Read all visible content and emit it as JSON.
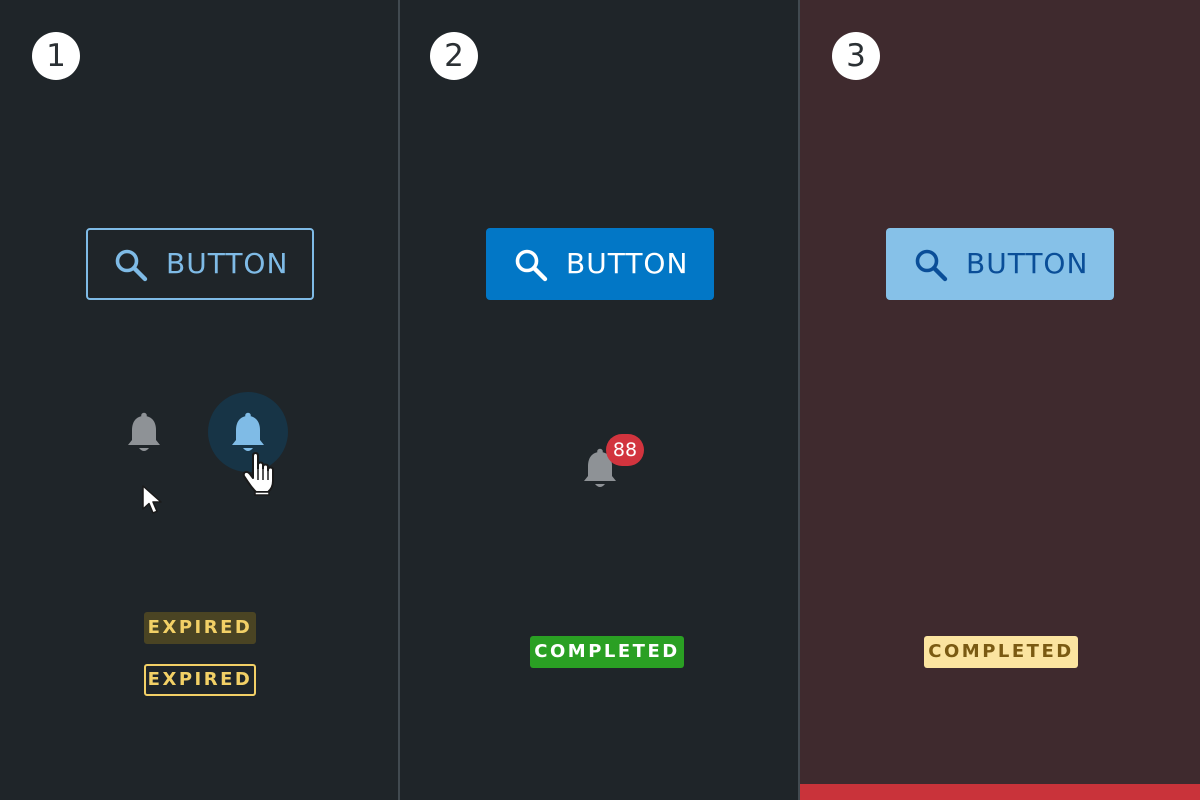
{
  "panels": [
    {
      "number": "1",
      "button": {
        "label": "BUTTON",
        "style": "outline",
        "icon": "search-icon"
      },
      "bells": [
        {
          "icon": "bell-icon",
          "state": "default"
        },
        {
          "icon": "bell-icon",
          "state": "hover"
        }
      ],
      "badges": [
        {
          "text": "EXPIRED",
          "style": "filled"
        },
        {
          "text": "EXPIRED",
          "style": "outline"
        }
      ]
    },
    {
      "number": "2",
      "button": {
        "label": "BUTTON",
        "style": "solid",
        "icon": "search-icon"
      },
      "bell": {
        "icon": "bell-icon",
        "count": "88"
      },
      "badges": [
        {
          "text": "COMPLETED",
          "style": "green"
        }
      ]
    },
    {
      "number": "3",
      "button": {
        "label": "BUTTON",
        "style": "light",
        "icon": "search-icon"
      },
      "badges": [
        {
          "text": "COMPLETED",
          "style": "yellow"
        }
      ]
    }
  ],
  "colors": {
    "panel_bg": "#1f2529",
    "panel3_bg": "#3f2a2e",
    "accent_blue": "#0277c6",
    "light_blue": "#86c1e8",
    "expired_yellow": "#f2d066",
    "completed_green": "#2aa023",
    "notification_red": "#d2343e"
  }
}
